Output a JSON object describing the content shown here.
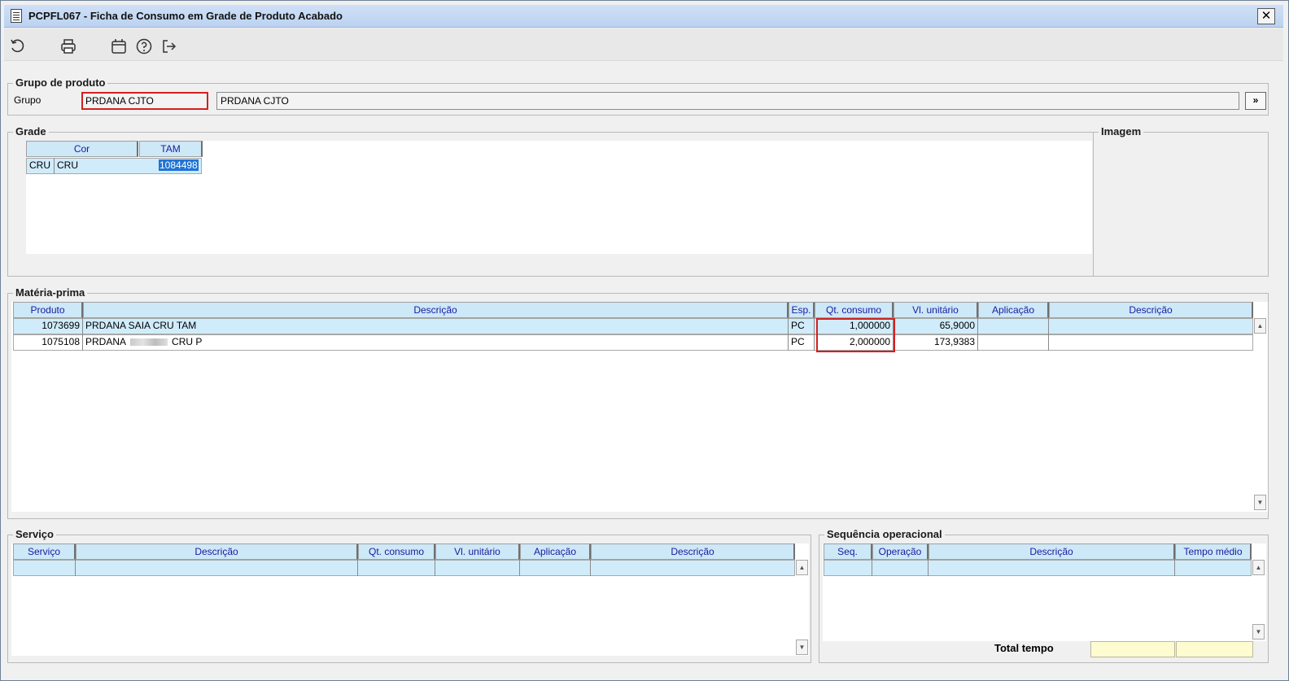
{
  "window": {
    "title": "PCPFL067 - Ficha de Consumo em Grade de Produto Acabado",
    "close_label": "✕"
  },
  "toolbar": {
    "icons": [
      "refresh-icon",
      "print-icon",
      "calendar-icon",
      "help-icon",
      "exit-icon"
    ]
  },
  "grupo_produto": {
    "legend": "Grupo de produto",
    "label": "Grupo",
    "code": "PRDANA CJTO",
    "description": "PRDANA CJTO",
    "nav_button": "»"
  },
  "grade": {
    "legend": "Grade",
    "headers": {
      "cor": "Cor",
      "tam": "TAM"
    },
    "row": {
      "cor_code": "CRU",
      "cor_name": "CRU",
      "tam_value": "1084498"
    }
  },
  "imagem": {
    "legend": "Imagem"
  },
  "materia_prima": {
    "legend": "Matéria-prima",
    "headers": [
      "Produto",
      "Descrição",
      "Esp.",
      "Qt. consumo",
      "Vl. unitário",
      "Aplicação",
      "Descrição"
    ],
    "rows": [
      {
        "produto": "1073699",
        "descricao": "PRDANA SAIA CRU TAM",
        "esp": "PC",
        "qt": "1,000000",
        "vl": "65,9000",
        "aplicacao": "",
        "descricao2": ""
      },
      {
        "produto": "1075108",
        "descricao": "PRDANA",
        "descricao_tail": "CRU P",
        "esp": "PC",
        "qt": "2,000000",
        "vl": "173,9383",
        "aplicacao": "",
        "descricao2": ""
      }
    ]
  },
  "servico": {
    "legend": "Serviço",
    "headers": [
      "Serviço",
      "Descrição",
      "Qt. consumo",
      "Vl. unitário",
      "Aplicação",
      "Descrição"
    ]
  },
  "sequencia": {
    "legend": "Sequência operacional",
    "headers": [
      "Seq.",
      "Operação",
      "Descrição",
      "Tempo médio"
    ],
    "total_label": "Total tempo"
  }
}
